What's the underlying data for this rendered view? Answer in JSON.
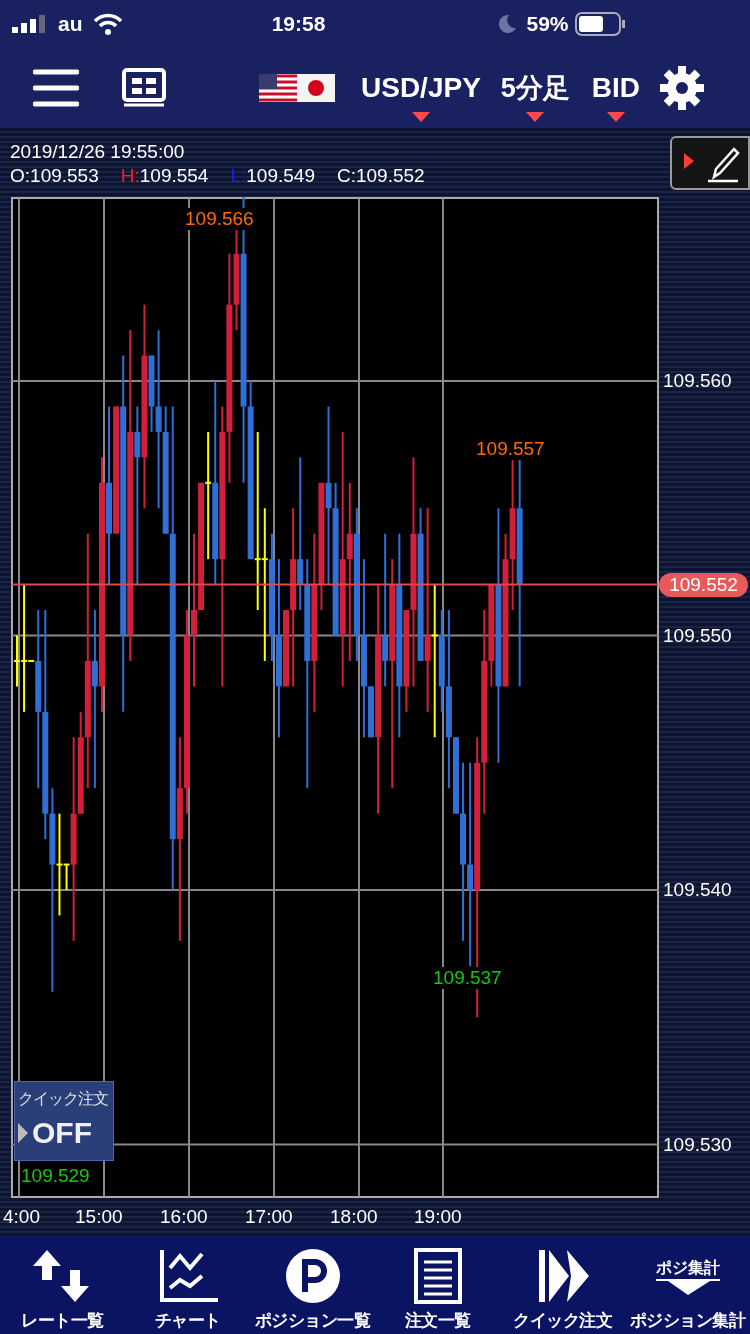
{
  "status_bar": {
    "carrier": "au",
    "time": "19:58",
    "battery": "59%"
  },
  "header": {
    "currency_pair": "USD/JPY",
    "timeframe": "5分足",
    "price_type": "BID"
  },
  "ohlc": {
    "datetime": "2019/12/26 19:55:00",
    "values": [
      {
        "label": "O:",
        "value": "109.553",
        "color": "#ffffff"
      },
      {
        "label": "H:",
        "value": "109.554",
        "color": "#ff1a1a"
      },
      {
        "label": "L:",
        "value": "109.549",
        "color": "#1a1aff"
      },
      {
        "label": "C:",
        "value": "109.552",
        "color": "#ffffff"
      }
    ]
  },
  "chart": {
    "y_labels": [
      "109.560",
      "109.550",
      "109.540",
      "109.530"
    ],
    "x_labels": [
      "4:00",
      "15:00",
      "16:00",
      "17:00",
      "18:00",
      "19:00"
    ],
    "markers": [
      {
        "text": "109.566",
        "color": "#ff6a00"
      },
      {
        "text": "109.557",
        "color": "#ff6a00"
      },
      {
        "text": "109.537",
        "color": "#16c60c"
      },
      {
        "text": "109.529",
        "color": "#16c60c"
      }
    ],
    "current_price": "109.552"
  },
  "quick_order": {
    "label": "クイック注文",
    "state": "OFF"
  },
  "nav": [
    {
      "label": "レート一覧"
    },
    {
      "label": "チャート"
    },
    {
      "label": "ポジション一覧"
    },
    {
      "label": "注文一覧"
    },
    {
      "label": "クイック注文"
    },
    {
      "label": "ポジション集計",
      "icon_text": "ポジ集計"
    }
  ]
}
